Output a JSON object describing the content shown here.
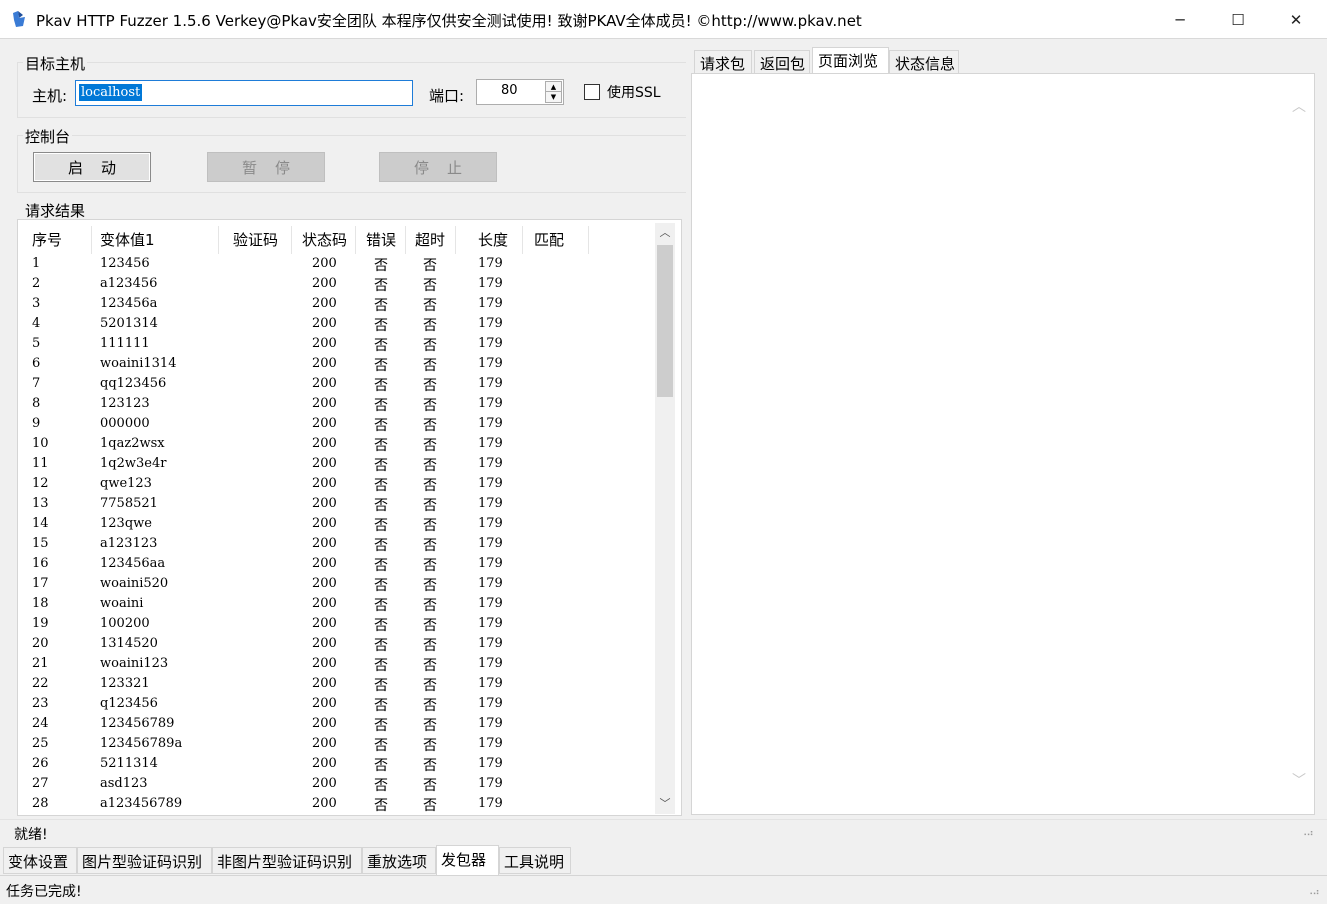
{
  "window": {
    "title": "Pkav HTTP Fuzzer 1.5.6  Verkey@Pkav安全团队  本程序仅供安全测试使用!  致谢PKAV全体成员! ©http://www.pkav.net",
    "min_glyph": "─",
    "max_glyph": "☐",
    "close_glyph": "✕"
  },
  "target": {
    "group_label": "目标主机",
    "host_label": "主机:",
    "host_value": "localhost",
    "port_label": "端口:",
    "port_value": "80",
    "ssl_label": "使用SSL",
    "ssl_checked": false
  },
  "console": {
    "group_label": "控制台",
    "start_label": "启动",
    "pause_label": "暂停",
    "stop_label": "停止"
  },
  "results": {
    "group_label": "请求结果",
    "columns": [
      "序号",
      "变体值1",
      "验证码",
      "状态码",
      "错误",
      "超时",
      "长度",
      "匹配"
    ],
    "rows": [
      [
        "1",
        "123456",
        "",
        "200",
        "否",
        "否",
        "179",
        ""
      ],
      [
        "2",
        "a123456",
        "",
        "200",
        "否",
        "否",
        "179",
        ""
      ],
      [
        "3",
        "123456a",
        "",
        "200",
        "否",
        "否",
        "179",
        ""
      ],
      [
        "4",
        "5201314",
        "",
        "200",
        "否",
        "否",
        "179",
        ""
      ],
      [
        "5",
        "111111",
        "",
        "200",
        "否",
        "否",
        "179",
        ""
      ],
      [
        "6",
        "woaini1314",
        "",
        "200",
        "否",
        "否",
        "179",
        ""
      ],
      [
        "7",
        "qq123456",
        "",
        "200",
        "否",
        "否",
        "179",
        ""
      ],
      [
        "8",
        "123123",
        "",
        "200",
        "否",
        "否",
        "179",
        ""
      ],
      [
        "9",
        "000000",
        "",
        "200",
        "否",
        "否",
        "179",
        ""
      ],
      [
        "10",
        "1qaz2wsx",
        "",
        "200",
        "否",
        "否",
        "179",
        ""
      ],
      [
        "11",
        "1q2w3e4r",
        "",
        "200",
        "否",
        "否",
        "179",
        ""
      ],
      [
        "12",
        "qwe123",
        "",
        "200",
        "否",
        "否",
        "179",
        ""
      ],
      [
        "13",
        "7758521",
        "",
        "200",
        "否",
        "否",
        "179",
        ""
      ],
      [
        "14",
        "123qwe",
        "",
        "200",
        "否",
        "否",
        "179",
        ""
      ],
      [
        "15",
        "a123123",
        "",
        "200",
        "否",
        "否",
        "179",
        ""
      ],
      [
        "16",
        "123456aa",
        "",
        "200",
        "否",
        "否",
        "179",
        ""
      ],
      [
        "17",
        "woaini520",
        "",
        "200",
        "否",
        "否",
        "179",
        ""
      ],
      [
        "18",
        "woaini",
        "",
        "200",
        "否",
        "否",
        "179",
        ""
      ],
      [
        "19",
        "100200",
        "",
        "200",
        "否",
        "否",
        "179",
        ""
      ],
      [
        "20",
        "1314520",
        "",
        "200",
        "否",
        "否",
        "179",
        ""
      ],
      [
        "21",
        "woaini123",
        "",
        "200",
        "否",
        "否",
        "179",
        ""
      ],
      [
        "22",
        "123321",
        "",
        "200",
        "否",
        "否",
        "179",
        ""
      ],
      [
        "23",
        "q123456",
        "",
        "200",
        "否",
        "否",
        "179",
        ""
      ],
      [
        "24",
        "123456789",
        "",
        "200",
        "否",
        "否",
        "179",
        ""
      ],
      [
        "25",
        "123456789a",
        "",
        "200",
        "否",
        "否",
        "179",
        ""
      ],
      [
        "26",
        "5211314",
        "",
        "200",
        "否",
        "否",
        "179",
        ""
      ],
      [
        "27",
        "asd123",
        "",
        "200",
        "否",
        "否",
        "179",
        ""
      ],
      [
        "28",
        "a123456789",
        "",
        "200",
        "否",
        "否",
        "179",
        ""
      ]
    ]
  },
  "right_tabs": {
    "items": [
      "请求包",
      "返回包",
      "页面浏览",
      "状态信息"
    ],
    "active_index": 2
  },
  "status_top": "就绪!",
  "bottom_tabs": {
    "items": [
      "变体设置",
      "图片型验证码识别",
      "非图片型验证码识别",
      "重放选项",
      "发包器",
      "工具说明"
    ],
    "active_index": 4
  },
  "status_bottom": "任务已完成!",
  "colors": {
    "selection": "#0078d7",
    "window_bg": "#f0f0f0",
    "button_face": "#e1e1e1"
  }
}
